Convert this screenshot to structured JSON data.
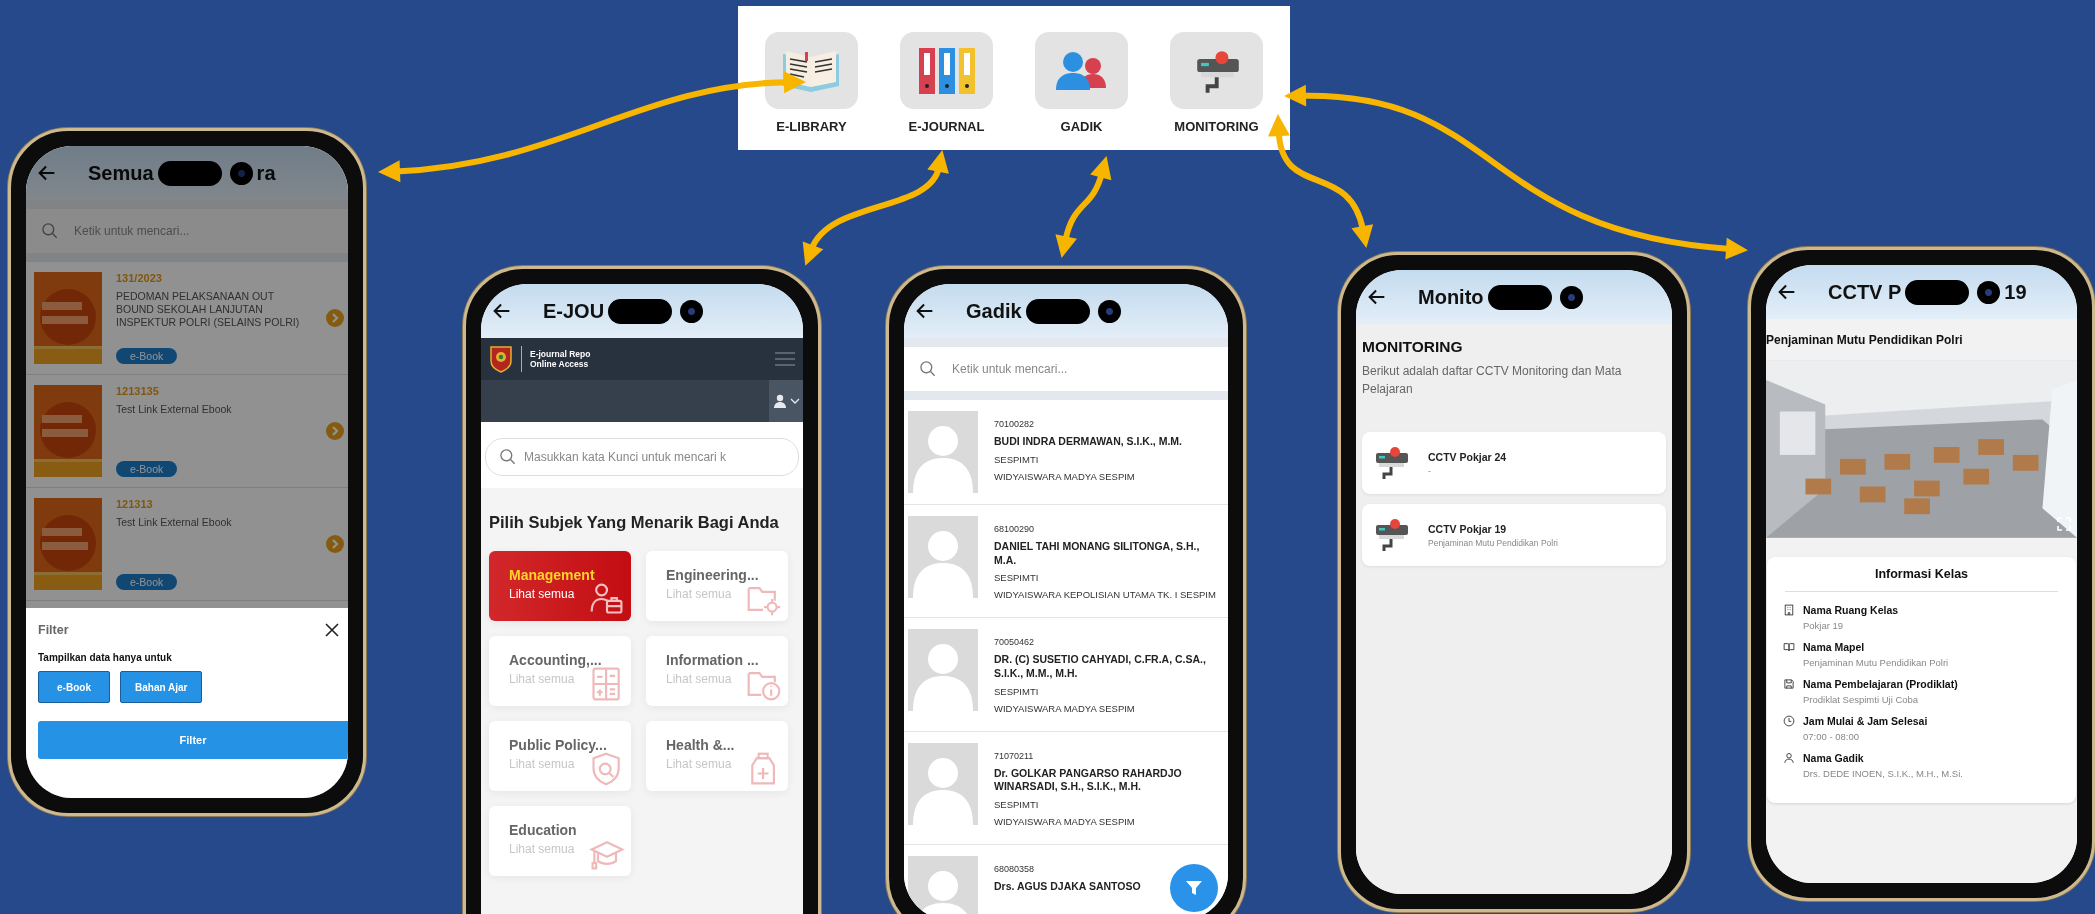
{
  "menu": {
    "items": [
      {
        "kind": "library",
        "label": "E-LIBRARY"
      },
      {
        "kind": "journal",
        "label": "E-JOURNAL"
      },
      {
        "kind": "gadik",
        "label": "GADIK"
      },
      {
        "kind": "monitoring",
        "label": "MONITORING"
      }
    ]
  },
  "elibrary_screen": {
    "title_parts": [
      "Semua",
      "ra"
    ],
    "search": {
      "placeholder": "Ketik untuk mencari..."
    },
    "books": [
      {
        "code": "131/2023",
        "title": "PEDOMAN PELAKSANAAN OUT BOUND SEKOLAH LANJUTAN INSPEKTUR POLRI (SELAINS POLRI)",
        "tag": "e-Book"
      },
      {
        "code": "1213135",
        "title": "Test Link External Ebook",
        "tag": "e-Book"
      },
      {
        "code": "121313",
        "title": "Test Link External Ebook",
        "tag": "e-Book"
      }
    ],
    "filter_sheet": {
      "title": "Filter",
      "prompt": "Tampilkan data hanya untuk",
      "options": [
        "e-Book",
        "Bahan Ajar"
      ],
      "submit": "Filter"
    }
  },
  "ejournal_screen": {
    "title_parts": [
      "E-JOU"
    ],
    "brand": [
      "E-journal Repo",
      "Online Access"
    ],
    "search": {
      "placeholder": "Masukkan kata Kunci untuk mencari k"
    },
    "heading": "Pilih Subjek Yang Menarik Bagi Anda",
    "subjects": [
      {
        "kind": "management",
        "name": "Management",
        "link": "Lihat semua",
        "selected": true
      },
      {
        "kind": "engineering",
        "name": "Engineering...",
        "link": "Lihat semua",
        "selected": false
      },
      {
        "kind": "accounting",
        "name": "Accounting,...",
        "link": "Lihat semua",
        "selected": false
      },
      {
        "kind": "information",
        "name": "Information ...",
        "link": "Lihat semua",
        "selected": false
      },
      {
        "kind": "policy",
        "name": "Public Policy...",
        "link": "Lihat semua",
        "selected": false
      },
      {
        "kind": "health",
        "name": "Health &...",
        "link": "Lihat semua",
        "selected": false
      },
      {
        "kind": "education",
        "name": "Education",
        "link": "Lihat semua",
        "selected": false
      }
    ]
  },
  "gadik_screen": {
    "title_parts": [
      "Gadik"
    ],
    "search": {
      "placeholder": "Ketik untuk mencari..."
    },
    "people": [
      {
        "nip": "70100282",
        "name": "BUDI INDRA DERMAWAN, S.I.K., M.M.",
        "unit": "SESPIMTI",
        "position": "WIDYAISWARA MADYA SESPIM"
      },
      {
        "nip": "68100290",
        "name": "DANIEL TAHI MONANG SILITONGA, S.H., M.A.",
        "unit": "SESPIMTI",
        "position": "WIDYAISWARA KEPOLISIAN UTAMA TK. I SESPIM"
      },
      {
        "nip": "70050462",
        "name": "DR. (C) SUSETIO CAHYADI, C.FR.A, C.SA., S.I.K., M.M., M.H.",
        "unit": "SESPIMTI",
        "position": "WIDYAISWARA MADYA SESPIM"
      },
      {
        "nip": "71070211",
        "name": "Dr. GOLKAR PANGARSO RAHARDJO WINARSADI, S.H., S.I.K., M.H.",
        "unit": "SESPIMTI",
        "position": "WIDYAISWARA MADYA SESPIM"
      },
      {
        "nip": "68080358",
        "name": "Drs. AGUS DJAKA SANTOSO"
      }
    ]
  },
  "monitoring_screen": {
    "title_parts": [
      "Monito"
    ],
    "heading": "MONITORING",
    "description": "Berikut adalah daftar CCTV Monitoring dan Mata Pelajaran",
    "cameras": [
      {
        "name": "CCTV Pokjar 24",
        "subtitle": "-"
      },
      {
        "name": "CCTV Pokjar 19",
        "subtitle": "Penjaminan Mutu Pendidikan Polri"
      }
    ]
  },
  "cctv_screen": {
    "title_parts": [
      "CCTV P",
      "19"
    ],
    "subject": "Penjaminan Mutu Pendidikan Polri",
    "info": {
      "title": "Informasi Kelas",
      "fields": [
        {
          "kind": "room",
          "label": "Nama Ruang Kelas",
          "value": "Pokjar 19"
        },
        {
          "kind": "book",
          "label": "Nama Mapel",
          "value": "Penjaminan Mutu Pendidikan Polri"
        },
        {
          "kind": "save",
          "label": "Nama Pembelajaran (Prodiklat)",
          "value": "Prodiklat Sespimti Uji Coba"
        },
        {
          "kind": "clock",
          "label": "Jam Mulai & Jam Selesai",
          "value": "07:00 - 08:00"
        },
        {
          "kind": "person",
          "label": "Nama Gadik",
          "value": "Drs. DEDE INOEN, S.I.K., M.H., M.Si."
        }
      ]
    }
  }
}
